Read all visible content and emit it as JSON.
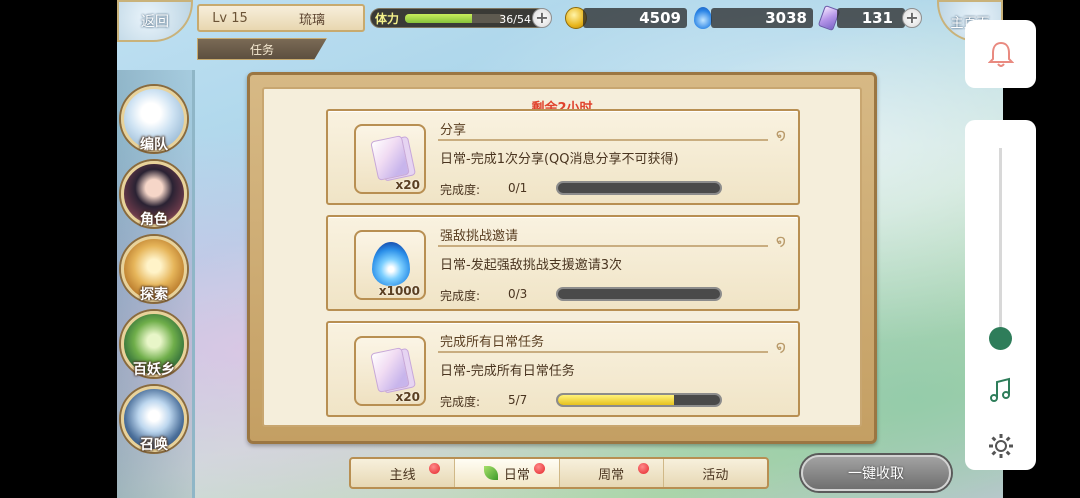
{
  "header": {
    "back_label": "返回",
    "level": "Lv 15",
    "player_name": "琉璃",
    "section_label": "任务",
    "stamina_label": "体力",
    "stamina_value": "36/54",
    "stamina_fraction": 0.667,
    "gold": "4509",
    "soul_fire": "3038",
    "crystal": "131",
    "home_label": "主页面"
  },
  "nav": [
    {
      "label": "编队"
    },
    {
      "label": "角色"
    },
    {
      "label": "探索"
    },
    {
      "label": "百妖乡"
    },
    {
      "label": "召唤"
    }
  ],
  "panel": {
    "time_left": "剩余2小时",
    "progress_label": "完成度:",
    "tasks": [
      {
        "title": "分享",
        "desc": "日常-完成1次分享(QQ消息分享不可获得)",
        "reward_qty": "x20",
        "reward_icon": "card-icon",
        "progress": "0/1",
        "fraction": 0
      },
      {
        "title": "强敌挑战邀请",
        "desc": "日常-发起强敌挑战支援邀请3次",
        "reward_qty": "x1000",
        "reward_icon": "blue-fire-icon",
        "progress": "0/3",
        "fraction": 0
      },
      {
        "title": "完成所有日常任务",
        "desc": "日常-完成所有日常任务",
        "reward_qty": "x20",
        "reward_icon": "card-icon",
        "progress": "5/7",
        "fraction": 0.714
      }
    ]
  },
  "tabs": [
    {
      "label": "主线",
      "active": false,
      "dot": true
    },
    {
      "label": "日常",
      "active": true,
      "dot": true
    },
    {
      "label": "周常",
      "active": false,
      "dot": true
    },
    {
      "label": "活动",
      "active": false,
      "dot": false
    }
  ],
  "collect_label": "一键收取",
  "system": {
    "volume_fraction": 0.05,
    "accent": "#2e7d5a"
  }
}
